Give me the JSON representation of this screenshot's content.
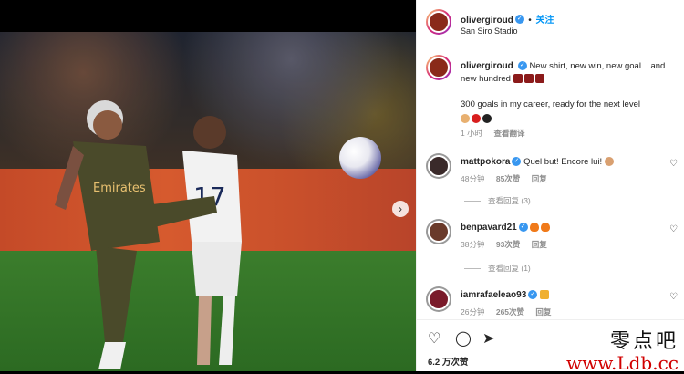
{
  "post": {
    "username": "olivergiroud",
    "verified": true,
    "follow_label": "关注",
    "location": "San Siro Stadio"
  },
  "caption": {
    "username": "olivergiroud",
    "text": "New shirt, new win, new goal... and new hundred",
    "line2": "300 goals in my career, ready for the next level",
    "time": "1 小时",
    "translate": "查看翻译"
  },
  "comments": [
    {
      "username": "mattpokora",
      "text": "Quel but! Encore lui!",
      "time": "48分钟",
      "likes": "85次赞",
      "reply": "回复",
      "replies": "查看回复 (3)"
    },
    {
      "username": "benpavard21",
      "text": "",
      "time": "38分钟",
      "likes": "93次赞",
      "reply": "回复",
      "replies": "查看回复 (1)"
    },
    {
      "username": "iamrafaeleao93",
      "text": "",
      "time": "26分钟",
      "likes": "265次赞",
      "reply": "回复"
    }
  ],
  "actions": {
    "like_count": "6.2 万次赞"
  },
  "watermark": {
    "cn": "零点吧",
    "url": "www.Ldb.cc"
  },
  "icons": {
    "like": "heart-icon",
    "comment": "comment-icon",
    "share": "share-icon",
    "next": "chevron-right-icon"
  },
  "colors": {
    "link_blue": "#0095f6",
    "verified": "#3897f0",
    "watermark_red": "#d10000"
  }
}
